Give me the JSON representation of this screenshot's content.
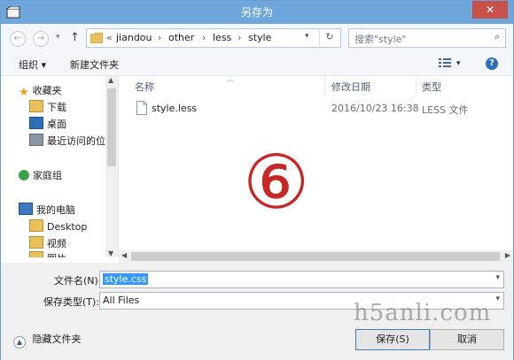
{
  "window": {
    "title": "另存为",
    "close_glyph": "✕"
  },
  "nav": {
    "back_glyph": "←",
    "forward_glyph": "→",
    "dropdown_glyph": "▾",
    "up_glyph": "↑",
    "address": {
      "overflow": "«",
      "segments": [
        "jiandou",
        "other",
        "less",
        "style"
      ],
      "sep": "›"
    },
    "refresh_glyph": "↻",
    "search": {
      "placeholder": "搜索\"style\"",
      "icon_glyph": "⌕"
    }
  },
  "toolbar": {
    "organize_label": "组织 ▾",
    "new_folder_label": "新建文件夹",
    "help_glyph": "?"
  },
  "sidebar": {
    "favorites": "收藏夹",
    "fav_items": [
      "下载",
      "桌面",
      "最近访问的位置"
    ],
    "homegroup": "家庭组",
    "computer": "我的电脑",
    "pc_items": [
      "Desktop",
      "视频",
      "图片"
    ]
  },
  "columns": {
    "name": "名称",
    "modified": "修改日期",
    "type": "类型"
  },
  "files": [
    {
      "name": "style.less",
      "modified": "2016/10/23 16:38",
      "type": "LESS 文件"
    }
  ],
  "annotation": "⑥",
  "form": {
    "filename_label": "文件名(N):",
    "filename_value": "style.css",
    "filetype_label": "保存类型(T):",
    "filetype_value": "All Files"
  },
  "footer": {
    "hide_folders_label": "隐藏文件夹",
    "save_label": "保存(S)",
    "cancel_label": "取消"
  },
  "watermark": "h5anli.com",
  "colors": {
    "titlebar": "#6fa7dc",
    "close": "#c7504a",
    "selection": "#3399ff"
  }
}
